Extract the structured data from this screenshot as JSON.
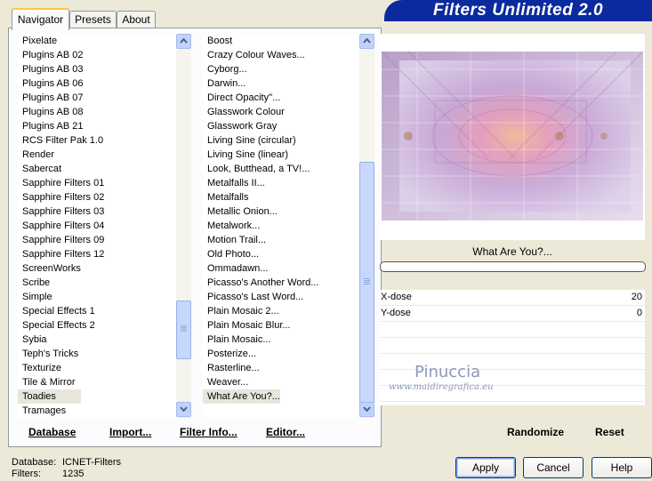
{
  "tabs": [
    {
      "label": "Navigator",
      "active": true
    },
    {
      "label": "Presets",
      "active": false
    },
    {
      "label": "About",
      "active": false
    }
  ],
  "banner_title": "Filters Unlimited 2.0",
  "categories": {
    "items": [
      "Pixelate",
      "Plugins AB 02",
      "Plugins AB 03",
      "Plugins AB 06",
      "Plugins AB 07",
      "Plugins AB 08",
      "Plugins AB 21",
      "RCS Filter Pak 1.0",
      "Render",
      "Sabercat",
      "Sapphire Filters 01",
      "Sapphire Filters 02",
      "Sapphire Filters 03",
      "Sapphire Filters 04",
      "Sapphire Filters 09",
      "Sapphire Filters 12",
      "ScreenWorks",
      "Scribe",
      "Simple",
      "Special Effects 1",
      "Special Effects 2",
      "Sybia",
      "Teph's Tricks",
      "Texturize",
      "Tile & Mirror",
      "Toadies",
      "Tramages"
    ],
    "selected": "Toadies"
  },
  "filters": {
    "items": [
      "Boost",
      "Crazy Colour Waves...",
      "Cyborg...",
      "Darwin...",
      "Direct Opacity''...",
      "Glasswork Colour",
      "Glasswork Gray",
      "Living Sine (circular)",
      "Living Sine (linear)",
      "Look, Butthead, a TV!...",
      "Metalfalls II...",
      "Metalfalls",
      "Metallic Onion...",
      "Metalwork...",
      "Motion Trail...",
      "Old Photo...",
      "Ommadawn...",
      "Picasso's Another Word...",
      "Picasso's Last Word...",
      "Plain Mosaic 2...",
      "Plain Mosaic Blur...",
      "Plain Mosaic...",
      "Posterize...",
      "Rasterline...",
      "Weaver...",
      "What Are You?..."
    ],
    "selected": "What Are You?..."
  },
  "panel_buttons": {
    "database": "Database",
    "import": "Import...",
    "filter_info": "Filter Info...",
    "editor": "Editor..."
  },
  "preview": {
    "filter_name": "What Are You?...",
    "watermark_name": "Pinuccia",
    "watermark_url": "www.maidiregrafica.eu"
  },
  "params": [
    {
      "label": "X-dose",
      "value": "20"
    },
    {
      "label": "Y-dose",
      "value": "0"
    }
  ],
  "right_buttons": {
    "randomize": "Randomize",
    "reset": "Reset"
  },
  "footer": {
    "database_label": "Database:",
    "database_value": "ICNET-Filters",
    "filters_label": "Filters:",
    "filters_value": "1235",
    "apply": "Apply",
    "cancel": "Cancel",
    "help": "Help"
  },
  "colors": {
    "banner": "#0a2a9e",
    "window_bg": "#ece9d8",
    "selected_bg": "#e8e6dc"
  }
}
